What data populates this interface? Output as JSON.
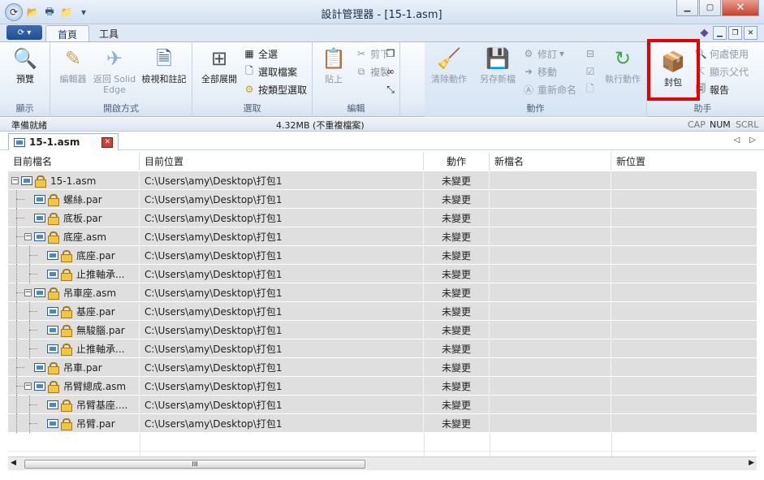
{
  "window": {
    "title": "設計管理器 - [15-1.asm]"
  },
  "tabs": [
    {
      "label": "首頁"
    },
    {
      "label": "工具"
    }
  ],
  "ribbon": {
    "groups": [
      {
        "label": "顯示",
        "buttons": [
          "預覽"
        ]
      },
      {
        "label": "開啟方式",
        "buttons": [
          "編輯器",
          "返回 Solid Edge",
          "檢視和註記"
        ]
      },
      {
        "label": "選取",
        "buttons": [
          "全部展開",
          "全選",
          "選取檔案",
          "按類型選取"
        ]
      },
      {
        "label": "編輯",
        "buttons": [
          "貼上",
          "剪下",
          "複製"
        ]
      },
      {
        "label": "動作",
        "buttons": [
          "清除動作",
          "另存新檔",
          "修訂",
          "移動",
          "重新命名",
          "執行動作"
        ]
      },
      {
        "label": "助手",
        "buttons": [
          "封包",
          "何處使用",
          "顯示父代",
          "報告"
        ]
      }
    ]
  },
  "status": {
    "left": "準備就緒",
    "center": "4.32MB (不重複檔案)",
    "cap": "CAP",
    "num": "NUM",
    "scrl": "SCRL"
  },
  "doc_tab": {
    "label": "15-1.asm"
  },
  "table": {
    "columns": [
      "目前檔名",
      "目前位置",
      "動作",
      "新檔名",
      "新位置"
    ],
    "rows": [
      {
        "name": "15-1.asm",
        "location": "C:\\Users\\amy\\Desktop\\打包1",
        "action": "未變更"
      },
      {
        "name": "螺絲.par",
        "location": "C:\\Users\\amy\\Desktop\\打包1",
        "action": "未變更"
      },
      {
        "name": "底板.par",
        "location": "C:\\Users\\amy\\Desktop\\打包1",
        "action": "未變更"
      },
      {
        "name": "底座.asm",
        "location": "C:\\Users\\amy\\Desktop\\打包1",
        "action": "未變更"
      },
      {
        "name": "底座.par",
        "location": "C:\\Users\\amy\\Desktop\\打包1",
        "action": "未變更"
      },
      {
        "name": "止推軸承...",
        "location": "C:\\Users\\amy\\Desktop\\打包1",
        "action": "未變更"
      },
      {
        "name": "吊車座.asm",
        "location": "C:\\Users\\amy\\Desktop\\打包1",
        "action": "未變更"
      },
      {
        "name": "基座.par",
        "location": "C:\\Users\\amy\\Desktop\\打包1",
        "action": "未變更"
      },
      {
        "name": "無駿腦.par",
        "location": "C:\\Users\\amy\\Desktop\\打包1",
        "action": "未變更"
      },
      {
        "name": "止推軸承...",
        "location": "C:\\Users\\amy\\Desktop\\打包1",
        "action": "未變更"
      },
      {
        "name": "吊車.par",
        "location": "C:\\Users\\amy\\Desktop\\打包1",
        "action": "未變更"
      },
      {
        "name": "吊臂總成.asm",
        "location": "C:\\Users\\amy\\Desktop\\打包1",
        "action": "未變更"
      },
      {
        "name": "吊臂基座....",
        "location": "C:\\Users\\amy\\Desktop\\打包1",
        "action": "未變更"
      },
      {
        "name": "吊臂.par",
        "location": "C:\\Users\\amy\\Desktop\\打包1",
        "action": "未變更"
      }
    ]
  },
  "scrollbar": {
    "thumb": "III"
  },
  "colors": {
    "highlight": "#e60000",
    "row_bg": "#dfdfdf",
    "accent": "#1f4e93"
  }
}
